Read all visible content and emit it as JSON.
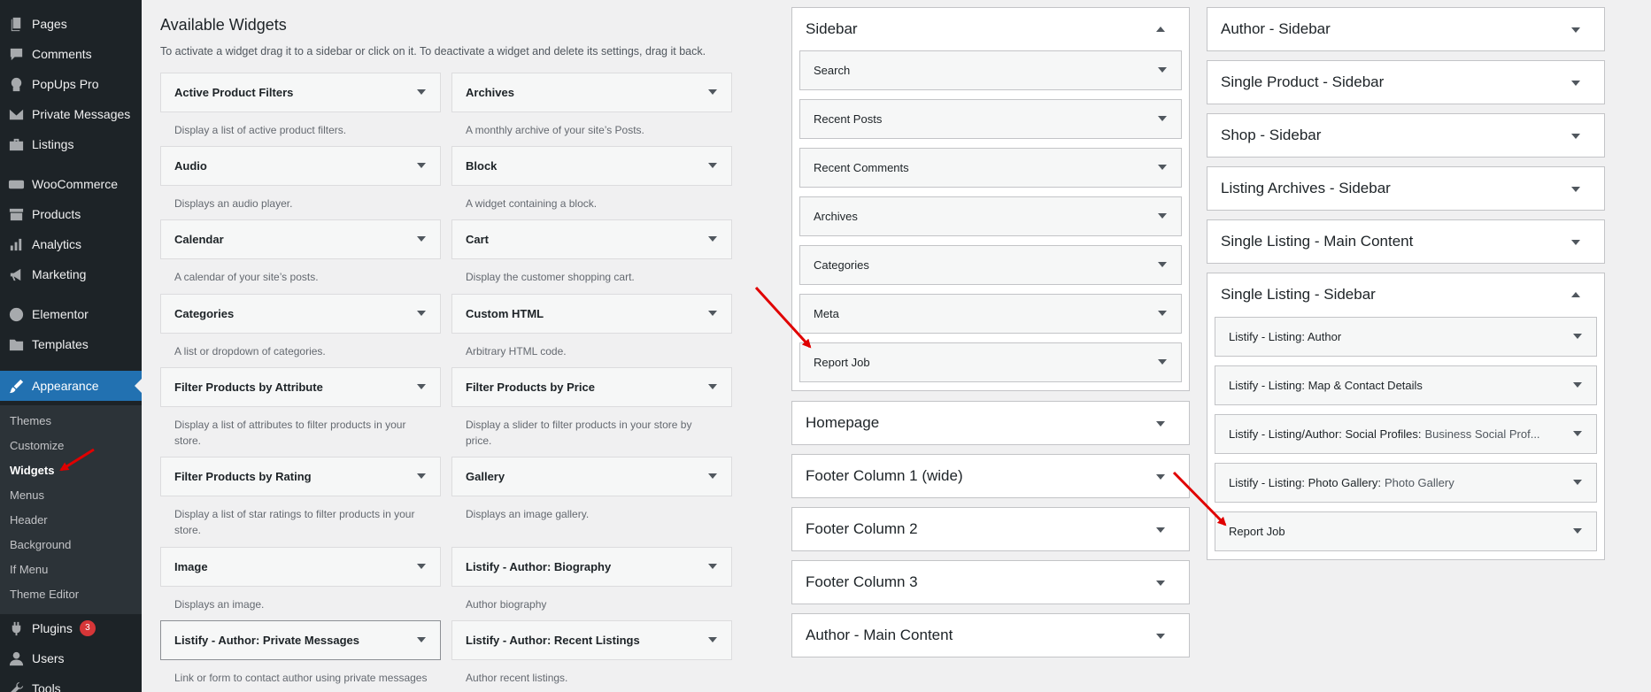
{
  "menu": {
    "pages": "Pages",
    "comments": "Comments",
    "popups": "PopUps Pro",
    "private_messages": "Private Messages",
    "listings": "Listings",
    "woocommerce": "WooCommerce",
    "products": "Products",
    "analytics": "Analytics",
    "marketing": "Marketing",
    "elementor": "Elementor",
    "templates": "Templates",
    "appearance": "Appearance",
    "plugins": "Plugins",
    "plugins_badge": "3",
    "users": "Users",
    "tools": "Tools"
  },
  "submenu": {
    "themes": "Themes",
    "customize": "Customize",
    "widgets": "Widgets",
    "menus": "Menus",
    "header": "Header",
    "background": "Background",
    "if_menu": "If Menu",
    "theme_editor": "Theme Editor"
  },
  "available": {
    "title": "Available Widgets",
    "description": "To activate a widget drag it to a sidebar or click on it. To deactivate a widget and delete its settings, drag it back.",
    "widgets": [
      {
        "name": "Active Product Filters",
        "desc1": "Display a list of active product filters.",
        "desc2": ""
      },
      {
        "name": "Archives",
        "desc1": "A monthly archive of your site’s Posts.",
        "desc2": ""
      },
      {
        "name": "Audio",
        "desc1": "Displays an audio player.",
        "desc2": ""
      },
      {
        "name": "Block",
        "desc1": "A widget containing a block.",
        "desc2": ""
      },
      {
        "name": "Calendar",
        "desc1": "A calendar of your site’s posts.",
        "desc2": ""
      },
      {
        "name": "Cart",
        "desc1": "Display the customer shopping cart.",
        "desc2": ""
      },
      {
        "name": "Categories",
        "desc1": "A list or dropdown of categories.",
        "desc2": ""
      },
      {
        "name": "Custom HTML",
        "desc1": "Arbitrary HTML code.",
        "desc2": ""
      },
      {
        "name": "Filter Products by Attribute",
        "desc1": "Display a list of attributes to filter products in your",
        "desc2": "store."
      },
      {
        "name": "Filter Products by Price",
        "desc1": "Display a slider to filter products in your store by",
        "desc2": "price."
      },
      {
        "name": "Filter Products by Rating",
        "desc1": "Display a list of star ratings to filter products in your",
        "desc2": "store."
      },
      {
        "name": "Gallery",
        "desc1": "Displays an image gallery.",
        "desc2": ""
      },
      {
        "name": "Image",
        "desc1": "Displays an image.",
        "desc2": ""
      },
      {
        "name": "Listify - Author: Biography",
        "desc1": "Author biography",
        "desc2": ""
      },
      {
        "name": "Listify - Author: Private Messages",
        "desc1": "Link or form to contact author using private messages",
        "desc2": ""
      },
      {
        "name": "Listify - Author: Recent Listings",
        "desc1": "Author recent listings.",
        "desc2": ""
      }
    ]
  },
  "sidebar_col": {
    "title": "Sidebar",
    "widgets": [
      "Search",
      "Recent Posts",
      "Recent Comments",
      "Archives",
      "Categories",
      "Meta",
      "Report Job"
    ],
    "collapsed": [
      "Homepage",
      "Footer Column 1 (wide)",
      "Footer Column 2",
      "Footer Column 3",
      "Author - Main Content"
    ]
  },
  "right_col": {
    "collapsed": [
      "Author - Sidebar",
      "Single Product - Sidebar",
      "Shop - Sidebar",
      "Listing Archives - Sidebar",
      "Single Listing - Main Content"
    ],
    "open_title": "Single Listing - Sidebar",
    "widgets": [
      {
        "name": "Listify - Listing: Author",
        "sub": ""
      },
      {
        "name": "Listify - Listing: Map & Contact Details",
        "sub": ""
      },
      {
        "name": "Listify - Listing/Author: Social Profiles:",
        "sub": "Business Social Prof..."
      },
      {
        "name": "Listify - Listing: Photo Gallery:",
        "sub": "Photo Gallery"
      },
      {
        "name": "Report Job",
        "sub": ""
      }
    ]
  },
  "colors": {
    "admin_bg": "#1d2327",
    "accent": "#2271b1",
    "annotation": "#e00000"
  }
}
